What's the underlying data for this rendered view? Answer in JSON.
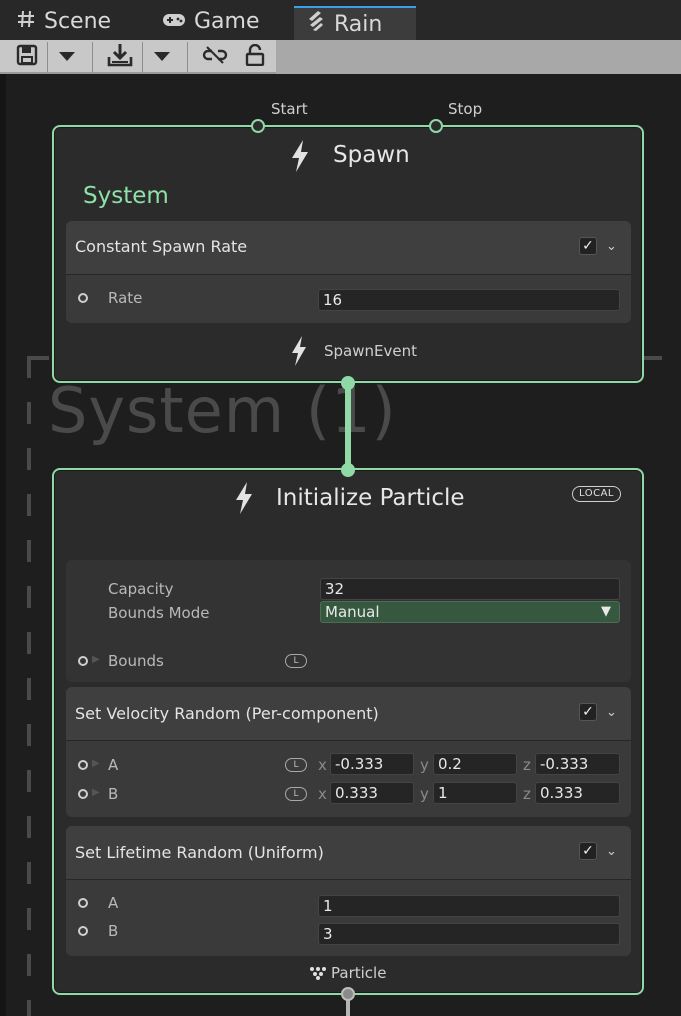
{
  "tabs": [
    {
      "label": "Scene",
      "icon": "hash-icon"
    },
    {
      "label": "Game",
      "icon": "gamepad-icon"
    },
    {
      "label": "Rain",
      "icon": "vfx-graph-icon",
      "active": true
    }
  ],
  "toolbar": {
    "items": [
      "save-icon",
      "dropdown-arrow",
      "export-icon",
      "dropdown-arrow",
      "link-icon",
      "lock-icon"
    ]
  },
  "canvas": {
    "watermark_title": "System (1)"
  },
  "spawn_node": {
    "title": "Spawn",
    "flow_inputs": [
      "Start",
      "Stop"
    ],
    "section_label": "System",
    "block": {
      "title": "Constant Spawn Rate",
      "enabled": true,
      "properties": [
        {
          "label": "Rate",
          "value": "16"
        }
      ]
    },
    "output_label": "SpawnEvent"
  },
  "init_node": {
    "title": "Initialize Particle",
    "space_badge": "LOCAL",
    "settings": {
      "capacity_label": "Capacity",
      "capacity_value": "32",
      "bounds_mode_label": "Bounds Mode",
      "bounds_mode_value": "Manual",
      "bounds_label": "Bounds",
      "bounds_space": "L"
    },
    "velocity_block": {
      "title": "Set Velocity Random (Per-component)",
      "enabled": true,
      "rows": [
        {
          "label": "A",
          "space": "L",
          "x": "-0.333",
          "y": "0.2",
          "z": "-0.333"
        },
        {
          "label": "B",
          "space": "L",
          "x": "0.333",
          "y": "1",
          "z": "0.333"
        }
      ]
    },
    "lifetime_block": {
      "title": "Set Lifetime Random (Uniform)",
      "enabled": true,
      "rows": [
        {
          "label": "A",
          "value": "1"
        },
        {
          "label": "B",
          "value": "3"
        }
      ]
    },
    "output_label": "Particle"
  },
  "colors": {
    "node_border": "#8fd9a6",
    "system_label": "#8fe0a8",
    "select_bg": "#35583e",
    "tab_accent": "#3aa0e8"
  }
}
